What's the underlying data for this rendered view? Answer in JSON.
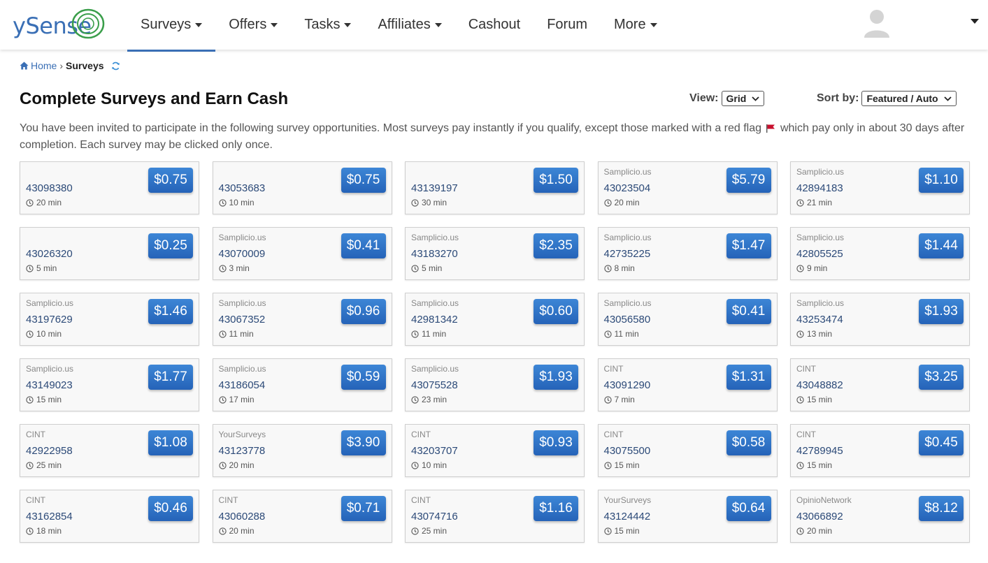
{
  "header": {
    "logo_text": "ySense",
    "nav": [
      {
        "label": "Surveys",
        "dropdown": true,
        "active": true
      },
      {
        "label": "Offers",
        "dropdown": true
      },
      {
        "label": "Tasks",
        "dropdown": true
      },
      {
        "label": "Affiliates",
        "dropdown": true
      },
      {
        "label": "Cashout",
        "dropdown": false
      },
      {
        "label": "Forum",
        "dropdown": false
      },
      {
        "label": "More",
        "dropdown": true
      }
    ]
  },
  "breadcrumb": {
    "home": "Home",
    "separator": "›",
    "current": "Surveys"
  },
  "title": "Complete Surveys and Earn Cash",
  "view": {
    "label": "View:",
    "value": "Grid"
  },
  "sort": {
    "label": "Sort by:",
    "value": "Featured / Auto"
  },
  "description": {
    "before_flag": "You have been invited to participate in the following survey opportunities. Most surveys pay instantly if you qualify, except those marked with a red flag",
    "after_flag": "which pay only in about 30 days after completion. Each survey may be clicked only once."
  },
  "colors": {
    "accent": "#3a6fb5",
    "button": "#2f72c8",
    "flag": "#c8102e"
  },
  "surveys": [
    {
      "provider": "",
      "id": "43098380",
      "duration": "20 min",
      "price": "$0.75"
    },
    {
      "provider": "",
      "id": "43053683",
      "duration": "10 min",
      "price": "$0.75"
    },
    {
      "provider": "",
      "id": "43139197",
      "duration": "30 min",
      "price": "$1.50"
    },
    {
      "provider": "Samplicio.us",
      "id": "43023504",
      "duration": "20 min",
      "price": "$5.79"
    },
    {
      "provider": "Samplicio.us",
      "id": "42894183",
      "duration": "21 min",
      "price": "$1.10"
    },
    {
      "provider": "",
      "id": "43026320",
      "duration": "5 min",
      "price": "$0.25"
    },
    {
      "provider": "Samplicio.us",
      "id": "43070009",
      "duration": "3 min",
      "price": "$0.41"
    },
    {
      "provider": "Samplicio.us",
      "id": "43183270",
      "duration": "5 min",
      "price": "$2.35"
    },
    {
      "provider": "Samplicio.us",
      "id": "42735225",
      "duration": "8 min",
      "price": "$1.47"
    },
    {
      "provider": "Samplicio.us",
      "id": "42805525",
      "duration": "9 min",
      "price": "$1.44"
    },
    {
      "provider": "Samplicio.us",
      "id": "43197629",
      "duration": "10 min",
      "price": "$1.46"
    },
    {
      "provider": "Samplicio.us",
      "id": "43067352",
      "duration": "11 min",
      "price": "$0.96"
    },
    {
      "provider": "Samplicio.us",
      "id": "42981342",
      "duration": "11 min",
      "price": "$0.60"
    },
    {
      "provider": "Samplicio.us",
      "id": "43056580",
      "duration": "11 min",
      "price": "$0.41"
    },
    {
      "provider": "Samplicio.us",
      "id": "43253474",
      "duration": "13 min",
      "price": "$1.93"
    },
    {
      "provider": "Samplicio.us",
      "id": "43149023",
      "duration": "15 min",
      "price": "$1.77"
    },
    {
      "provider": "Samplicio.us",
      "id": "43186054",
      "duration": "17 min",
      "price": "$0.59"
    },
    {
      "provider": "Samplicio.us",
      "id": "43075528",
      "duration": "23 min",
      "price": "$1.93"
    },
    {
      "provider": "CINT",
      "id": "43091290",
      "duration": "7 min",
      "price": "$1.31"
    },
    {
      "provider": "CINT",
      "id": "43048882",
      "duration": "15 min",
      "price": "$3.25"
    },
    {
      "provider": "CINT",
      "id": "42922958",
      "duration": "25 min",
      "price": "$1.08"
    },
    {
      "provider": "YourSurveys",
      "id": "43123778",
      "duration": "20 min",
      "price": "$3.90"
    },
    {
      "provider": "CINT",
      "id": "43203707",
      "duration": "10 min",
      "price": "$0.93"
    },
    {
      "provider": "CINT",
      "id": "43075500",
      "duration": "15 min",
      "price": "$0.58"
    },
    {
      "provider": "CINT",
      "id": "42789945",
      "duration": "15 min",
      "price": "$0.45"
    },
    {
      "provider": "CINT",
      "id": "43162854",
      "duration": "18 min",
      "price": "$0.46"
    },
    {
      "provider": "CINT",
      "id": "43060288",
      "duration": "20 min",
      "price": "$0.71"
    },
    {
      "provider": "CINT",
      "id": "43074716",
      "duration": "25 min",
      "price": "$1.16"
    },
    {
      "provider": "YourSurveys",
      "id": "43124442",
      "duration": "15 min",
      "price": "$0.64"
    },
    {
      "provider": "OpinioNetwork",
      "id": "43066892",
      "duration": "20 min",
      "price": "$8.12"
    }
  ]
}
